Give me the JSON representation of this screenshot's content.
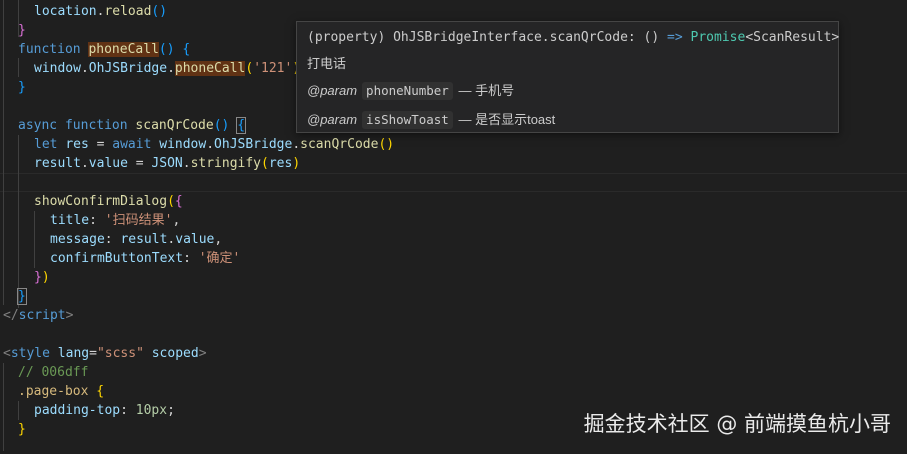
{
  "code": {
    "l1_obj": "location",
    "l1_fn": "reload",
    "l1_paren": "()",
    "l2_close": "}",
    "l3_kw": "function",
    "l3_fn": "phoneCall",
    "l3_paren": "()",
    "l3_brace": "{",
    "l4_obj": "window",
    "l4_prop": "OhJSBridge",
    "l4_fn": "phoneCall",
    "l4_open": "(",
    "l4_str": "'121'",
    "l4_close": ")",
    "l5_close": "}",
    "l7_async": "async",
    "l7_kw": "function",
    "l7_fn": "scanQrCode",
    "l7_paren": "()",
    "l7_brace": "{",
    "l8_let": "let",
    "l8_var": "res",
    "l8_eq": " = ",
    "l8_await": "await",
    "l8_obj": "window",
    "l8_prop": "OhJSBridge",
    "l8_fn": "scanQrCode",
    "l8_paren": "()",
    "l9_obj": "result",
    "l9_prop": "value",
    "l9_eq": " = ",
    "l9_json": "JSON",
    "l9_fn": "stringify",
    "l9_open": "(",
    "l9_arg": "res",
    "l9_close": ")",
    "l11_fn": "showConfirmDialog",
    "l11_open": "(",
    "l11_brace": "{",
    "l12_key": "title",
    "l12_str": "'扫码结果'",
    "l13_key": "message",
    "l13_obj": "result",
    "l13_prop": "value",
    "l14_key": "confirmButtonText",
    "l14_str": "'确定'",
    "l15_brace": "}",
    "l15_paren": ")",
    "l16_close": "}",
    "l17_tag": "script",
    "l19_tag": "style",
    "l19_attr": "lang",
    "l19_val": "\"scss\"",
    "l19_attr2": "scoped",
    "l20_cmt": "// 006dff",
    "l21_sel": ".page-box",
    "l21_brace": "{",
    "l22_prop": "padding-top",
    "l22_val": "10px",
    "l23_close": "}"
  },
  "hover": {
    "sig_prefix": "(property) OhJSBridgeInterface.scanQrCode: () ",
    "sig_arrow": "=>",
    "sig_type": "Promise",
    "sig_generic": "<ScanResult>",
    "description": "打电话",
    "params": [
      {
        "tag": "@param",
        "name": "phoneNumber",
        "desc": "— 手机号"
      },
      {
        "tag": "@param",
        "name": "isShowToast",
        "desc": "— 是否显示toast"
      }
    ]
  },
  "watermark": "掘金技术社区 @ 前端摸鱼杭小哥",
  "colors": {
    "background": "#1f1f1f",
    "keyword": "#569cd6",
    "function": "#dcdcaa",
    "variable": "#9cdcfe",
    "string": "#ce9178",
    "number": "#b5cea8",
    "comment": "#6a9955",
    "hover_bg": "#252526",
    "find_highlight": "#613214"
  }
}
